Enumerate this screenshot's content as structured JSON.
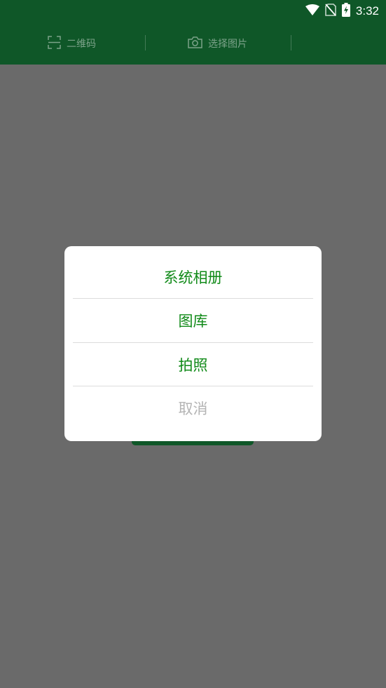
{
  "status_bar": {
    "time": "3:32",
    "icons": [
      "wifi-icon",
      "no-sim-icon",
      "battery-charging-icon"
    ]
  },
  "toolbar": {
    "tabs": [
      {
        "label": "二维码",
        "icon": "scan-frame-icon"
      },
      {
        "label": "选择图片",
        "icon": "camera-icon"
      }
    ]
  },
  "dialog": {
    "items": [
      {
        "label": "系统相册"
      },
      {
        "label": "图库"
      },
      {
        "label": "拍照"
      },
      {
        "label": "取消"
      }
    ]
  },
  "colors": {
    "header": "#0f5728",
    "overlay": "#6a6a6a",
    "option_text": "#108a18",
    "cancel_text": "#b4b4b4"
  }
}
